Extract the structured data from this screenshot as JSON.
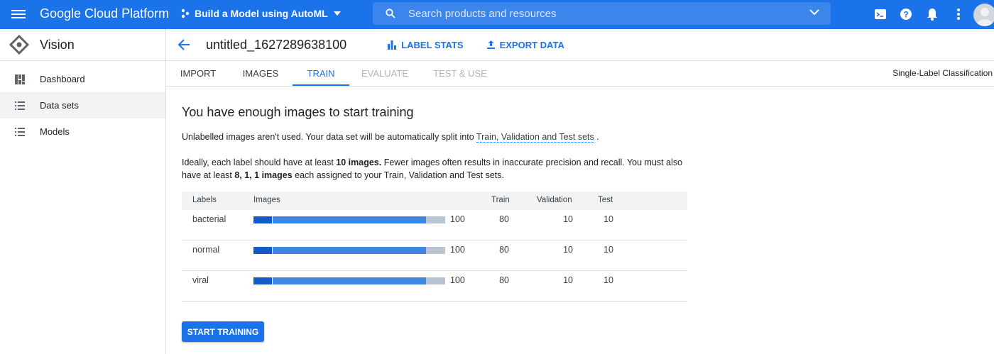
{
  "topbar": {
    "brand": "Google Cloud Platform",
    "project": "Build a Model using AutoML",
    "search_placeholder": "Search products and resources"
  },
  "sidebar": {
    "title": "Vision",
    "items": [
      {
        "label": "Dashboard",
        "icon": "dashboard-icon"
      },
      {
        "label": "Data sets",
        "icon": "list-icon",
        "active": true
      },
      {
        "label": "Models",
        "icon": "list-icon"
      }
    ]
  },
  "header": {
    "dataset_name": "untitled_1627289638100",
    "label_stats": "LABEL STATS",
    "export_data": "EXPORT DATA"
  },
  "tabs": [
    {
      "label": "IMPORT",
      "state": "normal"
    },
    {
      "label": "IMAGES",
      "state": "normal"
    },
    {
      "label": "TRAIN",
      "state": "active"
    },
    {
      "label": "EVALUATE",
      "state": "disabled"
    },
    {
      "label": "TEST & USE",
      "state": "disabled"
    }
  ],
  "model_type": "Single-Label Classification",
  "main": {
    "heading": "You have enough images to start training",
    "p1_text": "Unlabelled images aren't used. Your data set will be automatically split into",
    "p1_link": "Train, Validation and Test sets",
    "p1_end": ".",
    "p2_a": "Ideally, each label should have at least ",
    "p2_b": "10 images.",
    "p2_c": " Fewer images often results in inaccurate precision and recall. You must also have at least ",
    "p2_d": "8, 1, 1 images",
    "p2_e": " each assigned to your Train, Validation and Test sets."
  },
  "table": {
    "headers": [
      "Labels",
      "Images",
      "Train",
      "Validation",
      "Test"
    ],
    "rows": [
      {
        "label": "bacterial",
        "images": "100",
        "train": "80",
        "validation": "10",
        "test": "10",
        "fill_fraction": 0.9
      },
      {
        "label": "normal",
        "images": "100",
        "train": "80",
        "validation": "10",
        "test": "10",
        "fill_fraction": 0.9
      },
      {
        "label": "viral",
        "images": "100",
        "train": "80",
        "validation": "10",
        "test": "10",
        "fill_fraction": 0.9
      }
    ]
  },
  "start_button": "START TRAINING",
  "colors": {
    "accent": "#1a73e8",
    "bar_dark": "#1558c8",
    "bar_fill": "#3f86e3",
    "bar_empty": "#b8c4d2"
  }
}
